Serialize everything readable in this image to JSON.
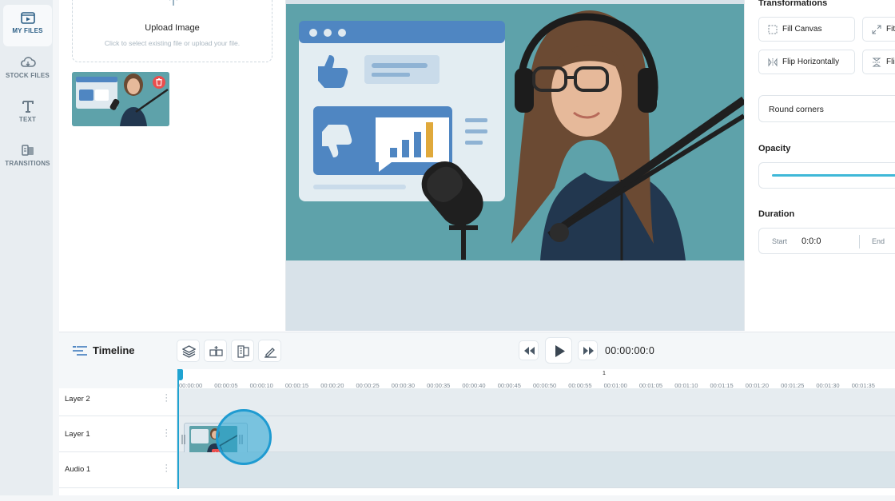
{
  "nav": {
    "items": [
      {
        "label": "MY FILES",
        "icon": "folder-play-icon",
        "active": true
      },
      {
        "label": "STOCK FILES",
        "icon": "cloud-icon",
        "active": false
      },
      {
        "label": "TEXT",
        "icon": "text-icon",
        "active": false
      },
      {
        "label": "TRANSITIONS",
        "icon": "transitions-icon",
        "active": false
      }
    ]
  },
  "files": {
    "upload_title": "Upload Image",
    "upload_subtitle": "Click to select existing file or upload your file."
  },
  "right_panel": {
    "transformations_title": "Transformations",
    "fill_canvas": "Fill Canvas",
    "fit": "Fit",
    "flip_horizontally": "Flip Horizontally",
    "flip_vertically": "Fli",
    "round_corners": "Round corners",
    "opacity_title": "Opacity",
    "duration_title": "Duration",
    "start_label": "Start",
    "start_value": "0:0:0",
    "end_label": "End"
  },
  "timeline": {
    "title": "Timeline",
    "timecode": "00:00:00:0",
    "marker": "1",
    "ticks": [
      "00:00:00",
      "00:00:05",
      "00:00:10",
      "00:00:15",
      "00:00:20",
      "00:00:25",
      "00:00:30",
      "00:00:35",
      "00:00:40",
      "00:00:45",
      "00:00:50",
      "00:00:55",
      "00:01:00",
      "00:01:05",
      "00:01:10",
      "00:01:15",
      "00:01:20",
      "00:01:25",
      "00:01:30",
      "00:01:35"
    ],
    "layers": [
      "Layer 2",
      "Layer 1",
      "Audio 1"
    ]
  },
  "colors": {
    "accent": "#1fa3d1",
    "delete": "#e94e4e",
    "image_bg": "#5ea2aa"
  }
}
